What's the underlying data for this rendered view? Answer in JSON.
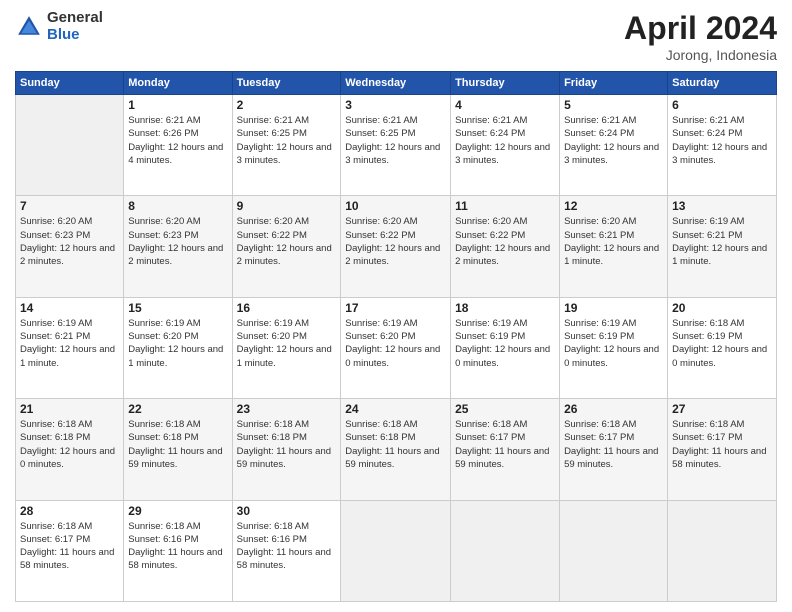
{
  "logo": {
    "general": "General",
    "blue": "Blue"
  },
  "header": {
    "month": "April 2024",
    "location": "Jorong, Indonesia"
  },
  "weekdays": [
    "Sunday",
    "Monday",
    "Tuesday",
    "Wednesday",
    "Thursday",
    "Friday",
    "Saturday"
  ],
  "weeks": [
    [
      {
        "day": null
      },
      {
        "day": 1,
        "sunrise": "6:21 AM",
        "sunset": "6:26 PM",
        "daylight": "12 hours and 4 minutes."
      },
      {
        "day": 2,
        "sunrise": "6:21 AM",
        "sunset": "6:25 PM",
        "daylight": "12 hours and 3 minutes."
      },
      {
        "day": 3,
        "sunrise": "6:21 AM",
        "sunset": "6:25 PM",
        "daylight": "12 hours and 3 minutes."
      },
      {
        "day": 4,
        "sunrise": "6:21 AM",
        "sunset": "6:24 PM",
        "daylight": "12 hours and 3 minutes."
      },
      {
        "day": 5,
        "sunrise": "6:21 AM",
        "sunset": "6:24 PM",
        "daylight": "12 hours and 3 minutes."
      },
      {
        "day": 6,
        "sunrise": "6:21 AM",
        "sunset": "6:24 PM",
        "daylight": "12 hours and 3 minutes."
      }
    ],
    [
      {
        "day": 7,
        "sunrise": "6:20 AM",
        "sunset": "6:23 PM",
        "daylight": "12 hours and 2 minutes."
      },
      {
        "day": 8,
        "sunrise": "6:20 AM",
        "sunset": "6:23 PM",
        "daylight": "12 hours and 2 minutes."
      },
      {
        "day": 9,
        "sunrise": "6:20 AM",
        "sunset": "6:22 PM",
        "daylight": "12 hours and 2 minutes."
      },
      {
        "day": 10,
        "sunrise": "6:20 AM",
        "sunset": "6:22 PM",
        "daylight": "12 hours and 2 minutes."
      },
      {
        "day": 11,
        "sunrise": "6:20 AM",
        "sunset": "6:22 PM",
        "daylight": "12 hours and 2 minutes."
      },
      {
        "day": 12,
        "sunrise": "6:20 AM",
        "sunset": "6:21 PM",
        "daylight": "12 hours and 1 minute."
      },
      {
        "day": 13,
        "sunrise": "6:19 AM",
        "sunset": "6:21 PM",
        "daylight": "12 hours and 1 minute."
      }
    ],
    [
      {
        "day": 14,
        "sunrise": "6:19 AM",
        "sunset": "6:21 PM",
        "daylight": "12 hours and 1 minute."
      },
      {
        "day": 15,
        "sunrise": "6:19 AM",
        "sunset": "6:20 PM",
        "daylight": "12 hours and 1 minute."
      },
      {
        "day": 16,
        "sunrise": "6:19 AM",
        "sunset": "6:20 PM",
        "daylight": "12 hours and 1 minute."
      },
      {
        "day": 17,
        "sunrise": "6:19 AM",
        "sunset": "6:20 PM",
        "daylight": "12 hours and 0 minutes."
      },
      {
        "day": 18,
        "sunrise": "6:19 AM",
        "sunset": "6:19 PM",
        "daylight": "12 hours and 0 minutes."
      },
      {
        "day": 19,
        "sunrise": "6:19 AM",
        "sunset": "6:19 PM",
        "daylight": "12 hours and 0 minutes."
      },
      {
        "day": 20,
        "sunrise": "6:18 AM",
        "sunset": "6:19 PM",
        "daylight": "12 hours and 0 minutes."
      }
    ],
    [
      {
        "day": 21,
        "sunrise": "6:18 AM",
        "sunset": "6:18 PM",
        "daylight": "12 hours and 0 minutes."
      },
      {
        "day": 22,
        "sunrise": "6:18 AM",
        "sunset": "6:18 PM",
        "daylight": "11 hours and 59 minutes."
      },
      {
        "day": 23,
        "sunrise": "6:18 AM",
        "sunset": "6:18 PM",
        "daylight": "11 hours and 59 minutes."
      },
      {
        "day": 24,
        "sunrise": "6:18 AM",
        "sunset": "6:18 PM",
        "daylight": "11 hours and 59 minutes."
      },
      {
        "day": 25,
        "sunrise": "6:18 AM",
        "sunset": "6:17 PM",
        "daylight": "11 hours and 59 minutes."
      },
      {
        "day": 26,
        "sunrise": "6:18 AM",
        "sunset": "6:17 PM",
        "daylight": "11 hours and 59 minutes."
      },
      {
        "day": 27,
        "sunrise": "6:18 AM",
        "sunset": "6:17 PM",
        "daylight": "11 hours and 58 minutes."
      }
    ],
    [
      {
        "day": 28,
        "sunrise": "6:18 AM",
        "sunset": "6:17 PM",
        "daylight": "11 hours and 58 minutes."
      },
      {
        "day": 29,
        "sunrise": "6:18 AM",
        "sunset": "6:16 PM",
        "daylight": "11 hours and 58 minutes."
      },
      {
        "day": 30,
        "sunrise": "6:18 AM",
        "sunset": "6:16 PM",
        "daylight": "11 hours and 58 minutes."
      },
      {
        "day": null
      },
      {
        "day": null
      },
      {
        "day": null
      },
      {
        "day": null
      }
    ]
  ]
}
